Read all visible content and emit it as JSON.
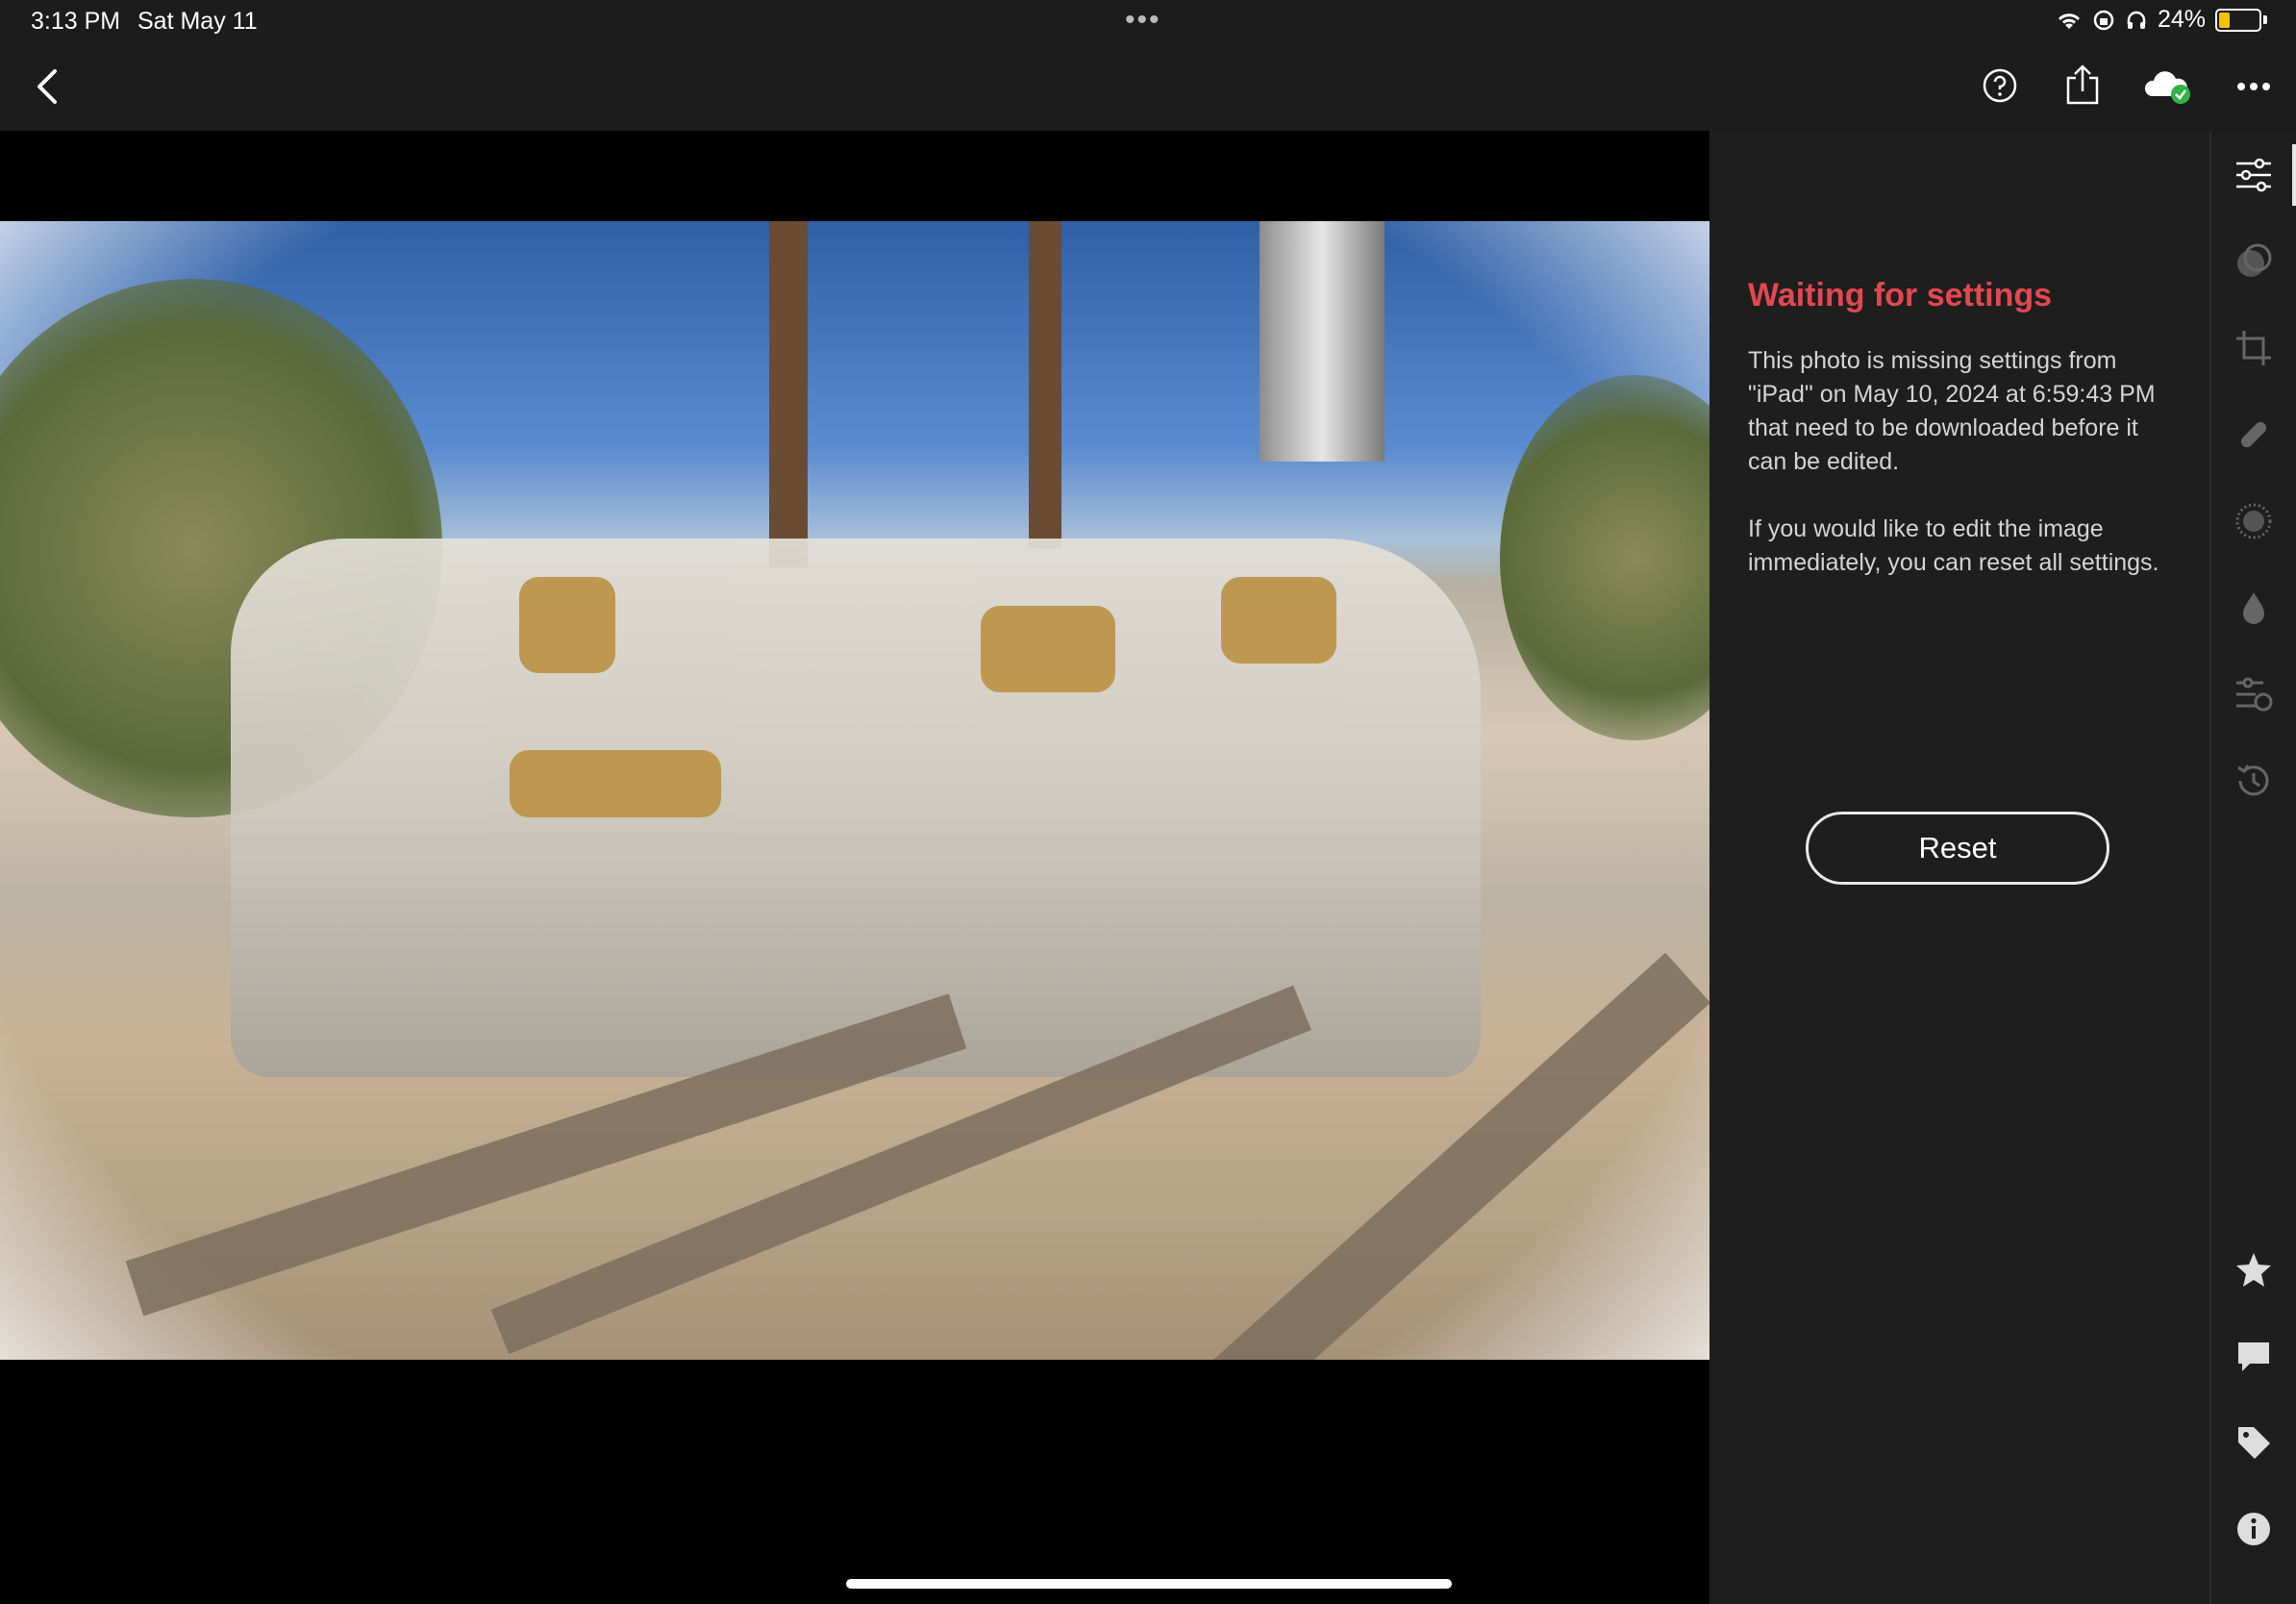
{
  "status_bar": {
    "time": "3:13 PM",
    "date": "Sat May 11",
    "battery": "24%"
  },
  "panel": {
    "title": "Waiting for settings",
    "message": "This photo is missing settings from \"iPad\" on May 10, 2024 at 6:59:43 PM that need to be downloaded before it can be edited.",
    "message2": "If you would like to edit the image immediately, you can reset all settings.",
    "reset_label": "Reset"
  },
  "colors": {
    "accent_red": "#e34850",
    "panel_bg": "#1e1e1e",
    "cloud_synced": "#2fb34a",
    "battery_charging": "#f5c400"
  },
  "icons": {
    "top": [
      "back-icon",
      "help-icon",
      "share-icon",
      "cloud-sync-icon",
      "more-icon"
    ],
    "tools": [
      "edit-sliders-icon",
      "masking-icon",
      "crop-icon",
      "healing-icon",
      "blur-icon",
      "color-drop-icon",
      "versions-icon",
      "history-icon",
      "rating-star-icon",
      "comment-icon",
      "tag-icon",
      "info-icon"
    ]
  }
}
